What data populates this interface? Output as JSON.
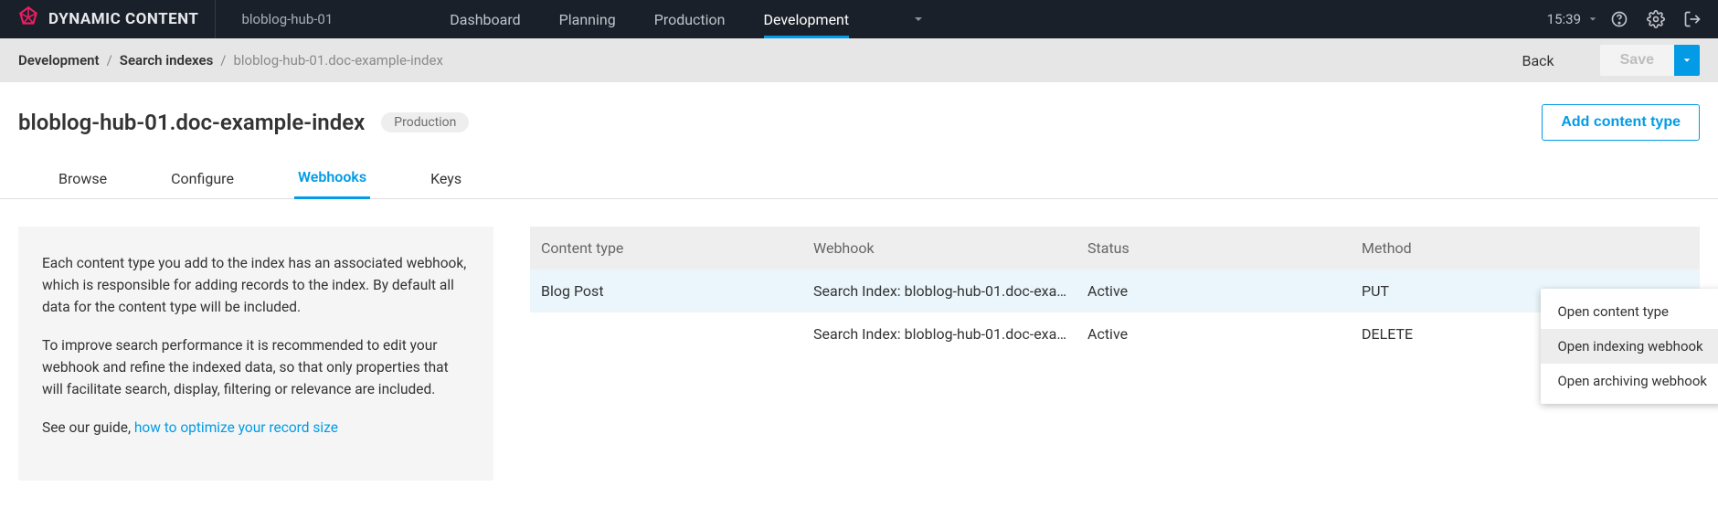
{
  "brand": "DYNAMIC CONTENT",
  "hub": "bloblog-hub-01",
  "nav": {
    "dashboard": "Dashboard",
    "planning": "Planning",
    "production": "Production",
    "development": "Development"
  },
  "clock": "15:39",
  "crumbs": {
    "c1": "Development",
    "c2": "Search indexes",
    "c3": "bloblog-hub-01.doc-example-index"
  },
  "toolbar": {
    "back": "Back",
    "save": "Save"
  },
  "header": {
    "title": "bloblog-hub-01.doc-example-index",
    "badge": "Production",
    "add": "Add content type"
  },
  "tabs": {
    "browse": "Browse",
    "configure": "Configure",
    "webhooks": "Webhooks",
    "keys": "Keys"
  },
  "info": {
    "p1": "Each content type you add to the index has an associated webhook, which is responsible for adding records to the index. By default all data for the content type will be included.",
    "p2": "To improve search performance it is recommended to edit your webhook and refine the indexed data, so that only properties that will facilitate search, display, filtering or relevance are included.",
    "p3_prefix": "See our guide, ",
    "p3_link": "how to optimize your record size"
  },
  "table": {
    "h_contenttype": "Content type",
    "h_webhook": "Webhook",
    "h_status": "Status",
    "h_method": "Method",
    "rows": [
      {
        "ct": "Blog Post",
        "wh": "Search Index: bloblog-hub-01.doc-exa…",
        "st": "Active",
        "me": "PUT"
      },
      {
        "ct": "",
        "wh": "Search Index: bloblog-hub-01.doc-exa…",
        "st": "Active",
        "me": "DELETE"
      }
    ]
  },
  "menu": {
    "m1": "Open content type",
    "m2": "Open indexing webhook",
    "m3": "Open archiving webhook"
  }
}
